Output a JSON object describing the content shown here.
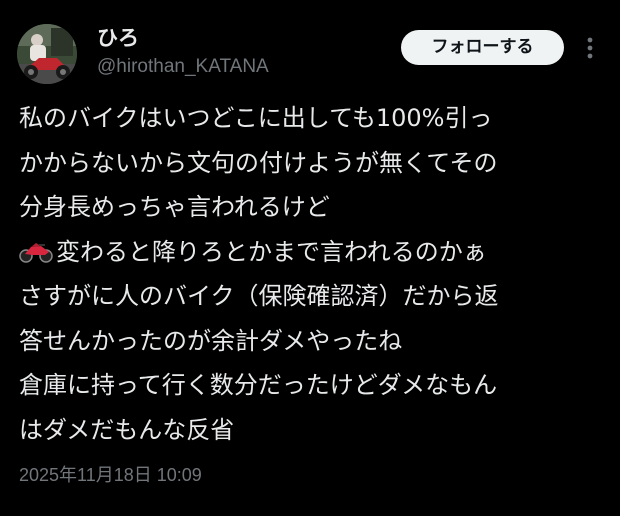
{
  "user": {
    "name": "ひろ",
    "handle": "@hirothan_KATANA"
  },
  "actions": {
    "follow_label": "フォローする",
    "more_icon": "more-vertical-icon"
  },
  "post": {
    "lines": [
      "私のバイクはいつどこに出しても100%引っ",
      "かからないから文句の付けようが無くてその",
      "分身長めっちゃ言われるけど",
      "変わると降りろとかまで言われるのかぁ",
      "さすがに人のバイク（保険確認済）だから返",
      "答せんかったのが余計ダメやったね",
      "倉庫に持って行く数分だったけどダメなもん",
      "はダメだもんな反省"
    ],
    "emoji_icon": "motorcycle-emoji-icon"
  },
  "timestamp": "2025年11月18日 10:09",
  "colors": {
    "background": "#000000",
    "text_primary": "#e7e9ea",
    "text_secondary": "#71767b",
    "follow_button_bg": "#eff3f4",
    "follow_button_text": "#0f1419"
  }
}
